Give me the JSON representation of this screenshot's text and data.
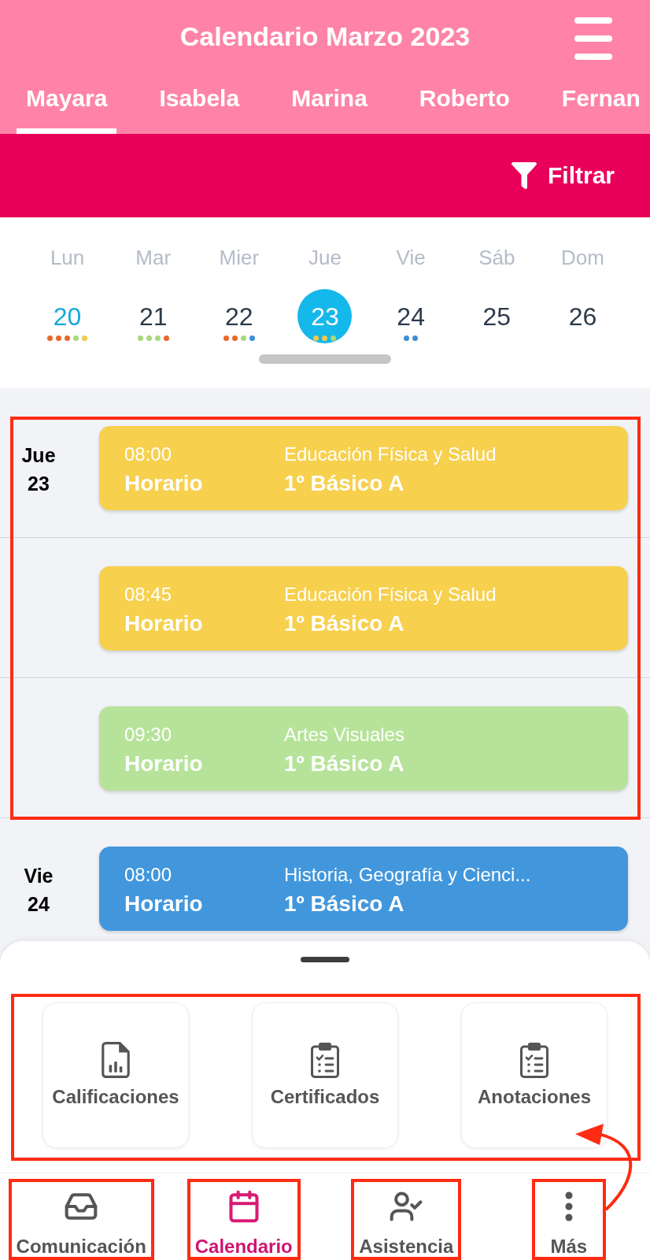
{
  "header": {
    "title": "Calendario Marzo 2023"
  },
  "tabs": [
    {
      "label": "Mayara",
      "selected": true
    },
    {
      "label": "Isabela",
      "selected": false
    },
    {
      "label": "Marina",
      "selected": false
    },
    {
      "label": "Roberto",
      "selected": false
    },
    {
      "label": "Fernan",
      "selected": false
    }
  ],
  "filter": {
    "label": "Filtrar"
  },
  "week": [
    {
      "day": "Lun",
      "date": "20",
      "today": true,
      "selected": false,
      "dots": [
        {
          "color": "#e8692b"
        },
        {
          "color": "#e8692b"
        },
        {
          "color": "#e8692b"
        },
        {
          "color": "#a7d97a"
        },
        {
          "color": "#f3c94a"
        }
      ]
    },
    {
      "day": "Mar",
      "date": "21",
      "today": false,
      "selected": false,
      "dots": [
        {
          "color": "#a7d97a"
        },
        {
          "color": "#a7d97a"
        },
        {
          "color": "#a7d97a"
        },
        {
          "color": "#e8692b"
        }
      ]
    },
    {
      "day": "Mier",
      "date": "22",
      "today": false,
      "selected": false,
      "dots": [
        {
          "color": "#e8692b"
        },
        {
          "color": "#e8692b"
        },
        {
          "color": "#a7d97a"
        },
        {
          "color": "#3f8fd6"
        }
      ]
    },
    {
      "day": "Jue",
      "date": "23",
      "today": false,
      "selected": true,
      "dots": [
        {
          "color": "#f3c94a"
        },
        {
          "color": "#f3c94a"
        },
        {
          "color": "#a7d97a"
        }
      ]
    },
    {
      "day": "Vie",
      "date": "24",
      "today": false,
      "selected": false,
      "dots": [
        {
          "color": "#3f8fd6"
        },
        {
          "color": "#3f8fd6"
        }
      ]
    },
    {
      "day": "Sáb",
      "date": "25",
      "today": false,
      "selected": false
    },
    {
      "day": "Dom",
      "date": "26",
      "today": false,
      "selected": false
    }
  ],
  "agenda": [
    {
      "day": "Jue",
      "date": "23",
      "highlighted": true,
      "events": [
        {
          "time": "08:00",
          "type": "Horario",
          "subject": "Educación Física y Salud",
          "group": "1º Básico A",
          "color": "#f7d04e"
        },
        {
          "time": "08:45",
          "type": "Horario",
          "subject": "Educación Física y Salud",
          "group": "1º Básico A",
          "color": "#f7d04e"
        },
        {
          "time": "09:30",
          "type": "Horario",
          "subject": "Artes Visuales",
          "group": "1º Básico A",
          "color": "#b6e399"
        }
      ]
    },
    {
      "day": "Vie",
      "date": "24",
      "highlighted": false,
      "events": [
        {
          "time": "08:00",
          "type": "Horario",
          "subject": "Historia, Geografía y Cienci...",
          "group": "1º Básico A",
          "color": "#4297dc"
        }
      ]
    }
  ],
  "shortcuts": {
    "highlighted": true,
    "items": [
      {
        "label": "Calificaciones"
      },
      {
        "label": "Certificados"
      },
      {
        "label": "Anotaciones"
      }
    ]
  },
  "bottom_nav": [
    {
      "label": "Comunicación",
      "selected": false,
      "highlighted": true
    },
    {
      "label": "Calendario",
      "selected": true,
      "highlighted": true
    },
    {
      "label": "Asistencia",
      "selected": false,
      "highlighted": true
    },
    {
      "label": "Más",
      "selected": false,
      "highlighted": true
    }
  ]
}
